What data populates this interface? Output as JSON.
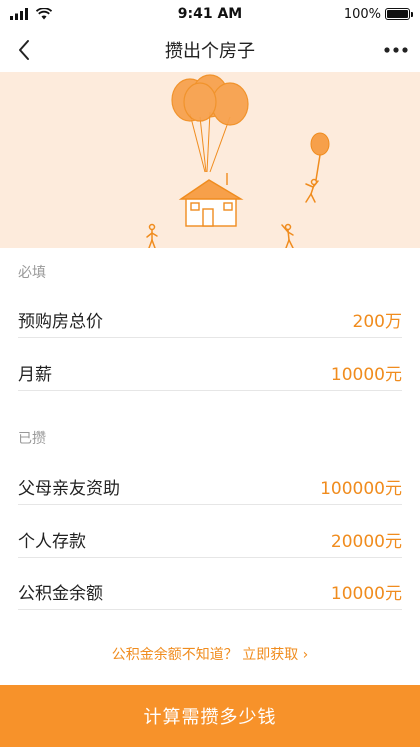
{
  "status_bar": {
    "time": "9:41 AM",
    "battery": "100%"
  },
  "nav": {
    "title": "攒出个房子"
  },
  "required": {
    "label": "必填",
    "rows": [
      {
        "label": "预购房总价",
        "value": "200万"
      },
      {
        "label": "月薪",
        "value": "10000元"
      }
    ]
  },
  "saved": {
    "label": "已攒",
    "rows": [
      {
        "label": "父母亲友资助",
        "value": "100000元"
      },
      {
        "label": "个人存款",
        "value": "20000元"
      },
      {
        "label": "公积金余额",
        "value": "10000元"
      }
    ]
  },
  "hint": {
    "text": "公积金余额不知道？ 立即获取 ›"
  },
  "cta": {
    "label": "计算需攒多少钱"
  },
  "colors": {
    "accent": "#f08c1e",
    "button": "#f7922a",
    "banner_bg": "#fdebdc"
  }
}
